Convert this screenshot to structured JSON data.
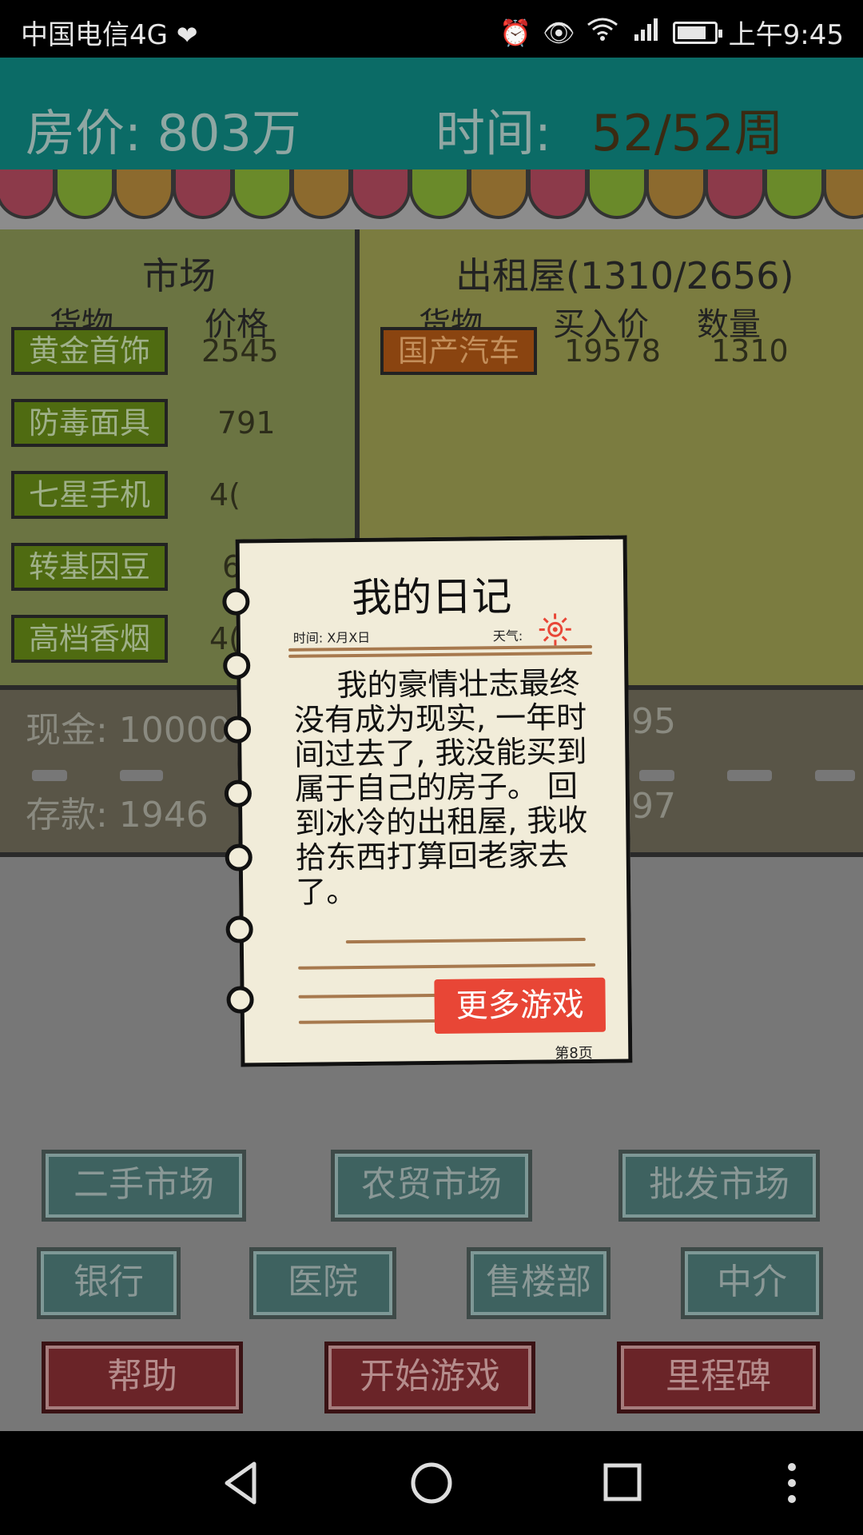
{
  "status_bar": {
    "carrier": "中国电信4G",
    "time": "上午9:45",
    "icons": [
      "heart-monitor-icon",
      "alarm-icon",
      "eye-icon",
      "wifi-icon",
      "signal-4g-icon",
      "battery-icon"
    ],
    "battery_level": 0.8
  },
  "header": {
    "price_label": "房价: 803万",
    "time_label": "时间:",
    "time_value": "52/52周"
  },
  "market": {
    "title": "市场",
    "col_goods": "货物",
    "col_price": "价格",
    "items": [
      {
        "name": "黄金首饰",
        "price": "2545"
      },
      {
        "name": "防毒面具",
        "price": "791"
      },
      {
        "name": "七星手机",
        "price": "4("
      },
      {
        "name": "转基因豆",
        "price": "6"
      },
      {
        "name": "高档香烟",
        "price": "4("
      }
    ]
  },
  "rental": {
    "title": "出租屋(1310/2656)",
    "col_goods": "货物",
    "col_buy_price": "买入价",
    "col_quantity": "数量",
    "items": [
      {
        "name": "国产汽车",
        "buy_price": "19578",
        "quantity": "1310"
      }
    ]
  },
  "finance": {
    "cash": "现金: 10000",
    "cash_right": "95",
    "deposit": "存款: 1946",
    "deposit_right": "97"
  },
  "diary": {
    "title": "我的日记",
    "time_meta": "时间: X月X日",
    "weather_meta": "天气:",
    "text": "我的豪情壮志最终没有成为现实, 一年时间过去了, 我没能买到属于自己的房子。 回到冰冷的出租屋, 我收拾东西打算回老家去了。",
    "more_games": "更多游戏",
    "page": "第8页"
  },
  "buttons": {
    "row1": [
      "二手市场",
      "农贸市场",
      "批发市场"
    ],
    "row2": [
      "银行",
      "医院",
      "售楼部",
      "中介"
    ],
    "row3": [
      "帮助",
      "开始游戏",
      "里程碑"
    ]
  },
  "colors": {
    "header_bg": "#0b6b66",
    "market_bg": "#6b7442",
    "diary_paper": "#f1ecd9",
    "more_games_btn": "#e84636"
  }
}
